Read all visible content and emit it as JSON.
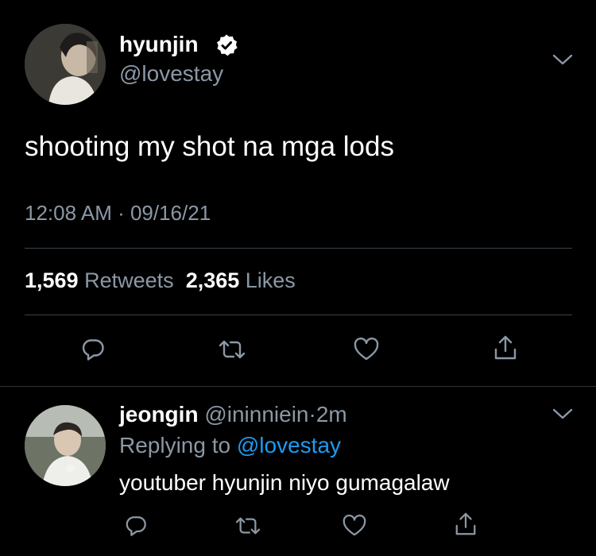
{
  "main_tweet": {
    "author": {
      "name": "hyunjin",
      "handle": "@lovestay",
      "verified": true,
      "avatar_icon": "profile-photo"
    },
    "text": "shooting my shot na mga lods",
    "timestamp": "12:08 AM · 09/16/21",
    "stats": {
      "retweets_count": "1,569",
      "retweets_label": "Retweets",
      "likes_count": "2,365",
      "likes_label": "Likes"
    },
    "actions": [
      "reply-icon",
      "retweet-icon",
      "like-icon",
      "share-icon"
    ]
  },
  "reply_tweet": {
    "author": {
      "name": "jeongin",
      "handle": "@ininniein",
      "avatar_icon": "profile-photo"
    },
    "separator": "·",
    "time": "2m",
    "replying_prefix": "Replying to",
    "replying_to": "@lovestay",
    "text": "youtuber hyunjin niyo gumagalaw",
    "actions": [
      "reply-icon",
      "retweet-icon",
      "like-icon",
      "share-icon"
    ]
  },
  "colors": {
    "background": "#000000",
    "text_primary": "#ffffff",
    "text_secondary": "#8b98a5",
    "accent": "#1d9bf0",
    "divider": "#38444d",
    "verified_badge": "#ffffff"
  }
}
